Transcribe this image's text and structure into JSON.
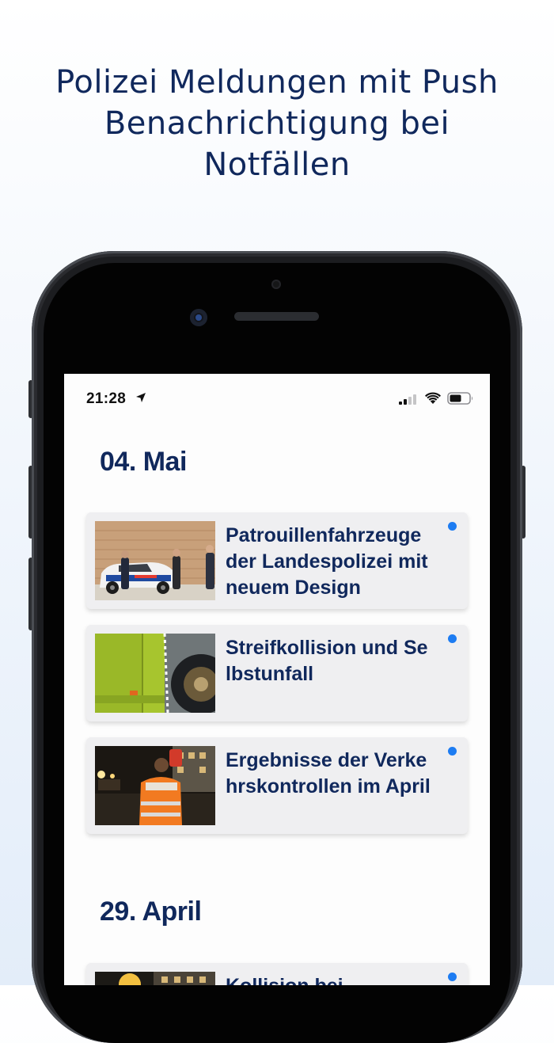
{
  "headline": {
    "line1": "Polizei Meldungen mit Push",
    "line2": "Benachrichtigung bei",
    "line3": "Notfällen"
  },
  "status_bar": {
    "time": "21:28",
    "icons": [
      "location-arrow-icon",
      "signal-icon",
      "wifi-icon",
      "battery-icon"
    ]
  },
  "sections": [
    {
      "date": "04. Mai",
      "items": [
        {
          "title": "Patrouillenfahrzeuge der Landespolizei mit neuem Design",
          "unread": true,
          "image": "police-car-photo"
        },
        {
          "title": "Streifkollision und Selbstunfall",
          "unread": true,
          "image": "bus-wheel-photo"
        },
        {
          "title": "Ergebnisse der Verkehrskontrollen im April",
          "unread": true,
          "image": "traffic-control-photo"
        }
      ]
    },
    {
      "date": "29. April",
      "items": [
        {
          "title": "Kollision bei",
          "unread": true,
          "image": "night-street-photo"
        }
      ]
    }
  ],
  "colors": {
    "brand_navy": "#10285c",
    "unread_dot": "#1d7cf2",
    "card_bg": "#efeff1"
  }
}
